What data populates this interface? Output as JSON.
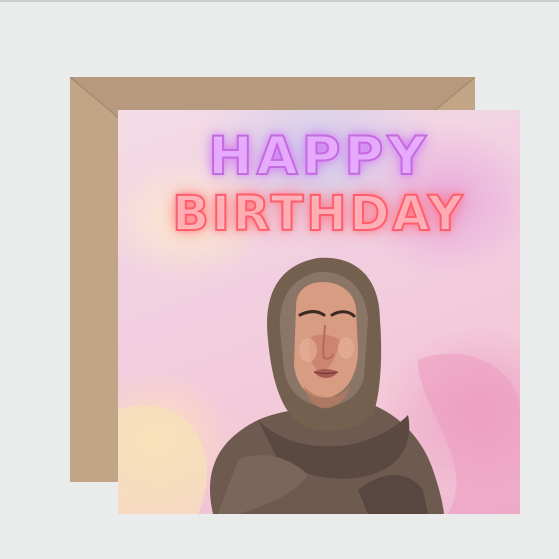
{
  "card": {
    "line1": "HAPPY",
    "line2": "BIRTHDAY"
  },
  "colors": {
    "background": "#e9ecea",
    "envelope": "#c2a587",
    "neon_purple": "#c56be0",
    "neon_red": "#ff5e6c",
    "scarf": "#6e5a4f"
  }
}
